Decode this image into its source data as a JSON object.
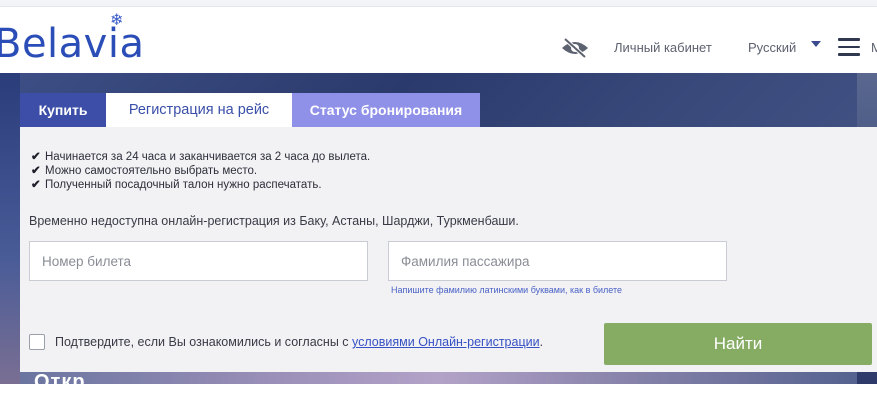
{
  "header": {
    "logo": "Belavia",
    "logo_icon": "snowflake-icon",
    "accessibility_icon": "low-vision-eye-icon",
    "account_label": "Личный кабинет",
    "language_label": "Русский",
    "menu_icon": "hamburger-menu-icon",
    "menu_truncated": "М"
  },
  "tabs": [
    {
      "label": "Купить"
    },
    {
      "label": "Регистрация на рейс"
    },
    {
      "label": "Статус бронирования"
    }
  ],
  "panel": {
    "checks": [
      "Начинается за 24 часа и заканчивается за 2 часа до вылета.",
      "Можно самостоятельно выбрать место.",
      "Полученный посадочный талон нужно распечатать."
    ],
    "notice": "Временно недоступна онлайн-регистрация из Баку, Астаны, Шарджи, Туркменбаши.",
    "ticket_placeholder": "Номер билета",
    "surname_placeholder": "Фамилия пассажира",
    "surname_hint": "Напишите фамилию латинскими буквами, как в билете",
    "agree_text": "Подтвердите, если Вы ознакомились и согласны с ",
    "agree_link": "условиями Онлайн-регистрации",
    "agree_end": ".",
    "search_button": "Найти"
  },
  "background": {
    "bottom_text": "Откр"
  },
  "colors": {
    "brand": "#2b4db8",
    "tab_active": "#3c4ea8",
    "tab_status": "#8f90e8",
    "button": "#86ac64"
  }
}
